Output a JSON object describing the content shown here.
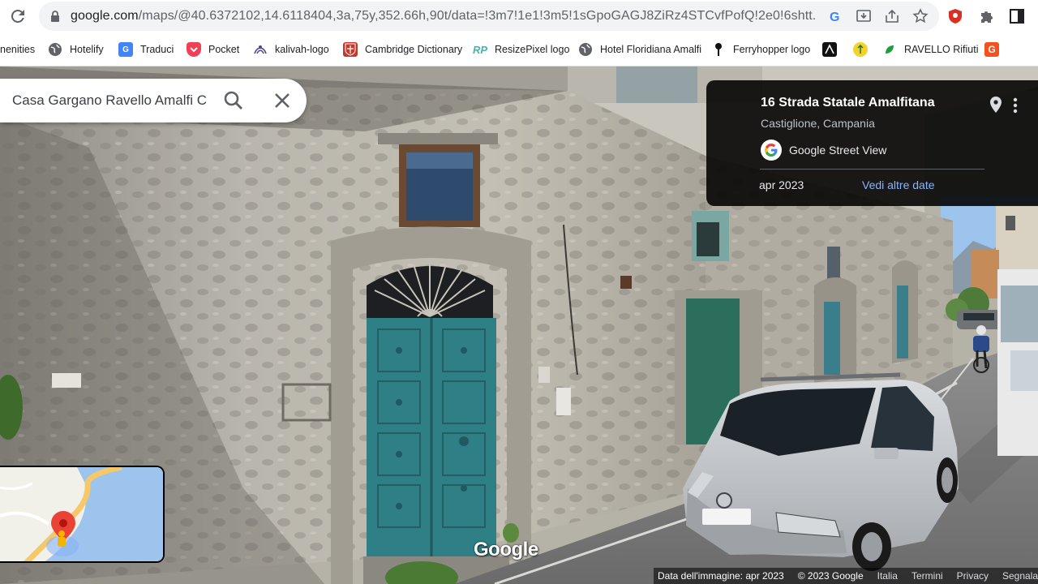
{
  "browser": {
    "url_host": "google.com",
    "url_path": "/maps/@40.6372102,14.6118404,3a,75y,352.66h,90t/data=!3m7!1e1!3m5!1sGpoGAGJ8ZiRz4STCvfPofQ!2e0!6shtt..."
  },
  "bookmarks": [
    {
      "label": "nenities"
    },
    {
      "label": "Hotelify"
    },
    {
      "label": "Traduci"
    },
    {
      "label": "Pocket"
    },
    {
      "label": "kalivah-logo"
    },
    {
      "label": "Cambridge Dictionary"
    },
    {
      "label": "ResizePixel logo"
    },
    {
      "label": "Hotel Floridiana Amalfi"
    },
    {
      "label": "Ferryhopper logo"
    },
    {
      "label": "RAVELLO Rifiuti"
    }
  ],
  "search": {
    "value": "Casa Gargano Ravello Amalfi C"
  },
  "infocard": {
    "title": "16 Strada Statale Amalfitana",
    "subtitle": "Castiglione, Campania",
    "source": "Google Street View",
    "date": "apr 2023",
    "more_dates": "Vedi altre date"
  },
  "watermark": "Google",
  "footer": {
    "image_date": "Data dell'immagine: apr 2023",
    "copyright": "© 2023 Google",
    "country": "Italia",
    "terms": "Termini",
    "privacy": "Privacy",
    "report": "Segnala un problema"
  },
  "colors": {
    "door": "#2f7f86",
    "wall": "#b9b6ad",
    "sky": "#9cc4ec",
    "link": "#8ab4f8"
  }
}
